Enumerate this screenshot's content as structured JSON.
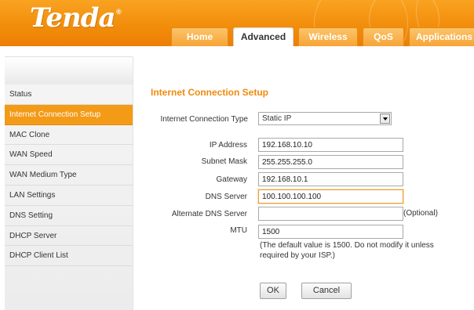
{
  "brand": {
    "logo_text": "Tenda",
    "logo_mark": "®"
  },
  "tabs": [
    {
      "label": "Home"
    },
    {
      "label": "Advanced"
    },
    {
      "label": "Wireless"
    },
    {
      "label": "QoS"
    },
    {
      "label": "Applications"
    }
  ],
  "sidebar": {
    "items": [
      {
        "label": "Status"
      },
      {
        "label": "Internet Connection Setup"
      },
      {
        "label": "MAC Clone"
      },
      {
        "label": "WAN Speed"
      },
      {
        "label": "WAN Medium Type"
      },
      {
        "label": "LAN Settings"
      },
      {
        "label": "DNS Setting"
      },
      {
        "label": "DHCP Server"
      },
      {
        "label": "DHCP Client List"
      }
    ]
  },
  "main": {
    "title": "Internet Connection Setup",
    "connection_type": {
      "label": "Internet Connection Type",
      "value": "Static IP"
    },
    "ip_address": {
      "label": "IP Address",
      "value": "192.168.10.10"
    },
    "subnet_mask": {
      "label": "Subnet Mask",
      "value": "255.255.255.0"
    },
    "gateway": {
      "label": "Gateway",
      "value": "192.168.10.1"
    },
    "dns_server": {
      "label": "DNS Server",
      "value": "100.100.100.100"
    },
    "alt_dns": {
      "label": "Alternate DNS Server",
      "value": "",
      "hint": "(Optional)"
    },
    "mtu": {
      "label": "MTU",
      "value": "1500",
      "note": "(The default value is 1500. Do not modify it unless required by your ISP.)"
    },
    "ok_label": "OK",
    "cancel_label": "Cancel"
  },
  "colors": {
    "accent": "#f39a17",
    "title": "#f08a0d",
    "header": "#f28e0c"
  }
}
